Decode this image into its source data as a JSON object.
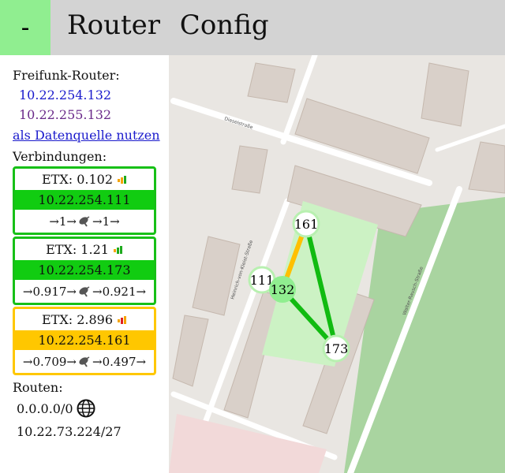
{
  "header": {
    "menu_label": "-",
    "title": "Router Config"
  },
  "sidebar": {
    "router_heading": "Freifunk-Router:",
    "router_ips": [
      "10.22.254.132",
      "10.22.255.132"
    ],
    "use_as_source_link": "als Datenquelle nutzen",
    "connections_heading": "Verbindungen:",
    "connections": [
      {
        "etx": "ETX: 0.102",
        "address": "10.22.254.111",
        "path_in": "→1→",
        "path_out": "→1→",
        "status": "green",
        "signal_icon": "signal-strong-icon"
      },
      {
        "etx": "ETX: 1.21",
        "address": "10.22.254.173",
        "path_in": "→0.917→",
        "path_out": "→0.921→",
        "status": "green",
        "signal_icon": "signal-strong-icon"
      },
      {
        "etx": "ETX: 2.896",
        "address": "10.22.254.161",
        "path_in": "→0.709→",
        "path_out": "→0.497→",
        "status": "yellow",
        "signal_icon": "signal-medium-icon"
      }
    ],
    "routes_heading": "Routen:",
    "routes": [
      {
        "prefix": "0.0.0.0/0",
        "icon": "globe-icon"
      },
      {
        "prefix": "10.22.73.224/27",
        "icon": ""
      }
    ]
  },
  "map": {
    "nodes": [
      {
        "label": "161",
        "role": "neighbor"
      },
      {
        "label": "111",
        "role": "neighbor"
      },
      {
        "label": "132",
        "role": "self"
      },
      {
        "label": "173",
        "role": "neighbor"
      }
    ],
    "links": [
      {
        "from": "132",
        "to": "161",
        "color": "#ffc000"
      },
      {
        "from": "132",
        "to": "111",
        "color": "#11bb11"
      },
      {
        "from": "132",
        "to": "173",
        "color": "#11bb11"
      },
      {
        "from": "161",
        "to": "173",
        "color": "#11bb11"
      }
    ],
    "street_labels": [
      "Dieselstraße",
      "Heinrich-von-Kleist-Straße",
      "Walter-Rausch-Straße"
    ],
    "colors": {
      "link_good": "#11bb11",
      "link_medium": "#ffc000",
      "park": "#ccf2c4",
      "forest": "#a9d4a0"
    }
  }
}
